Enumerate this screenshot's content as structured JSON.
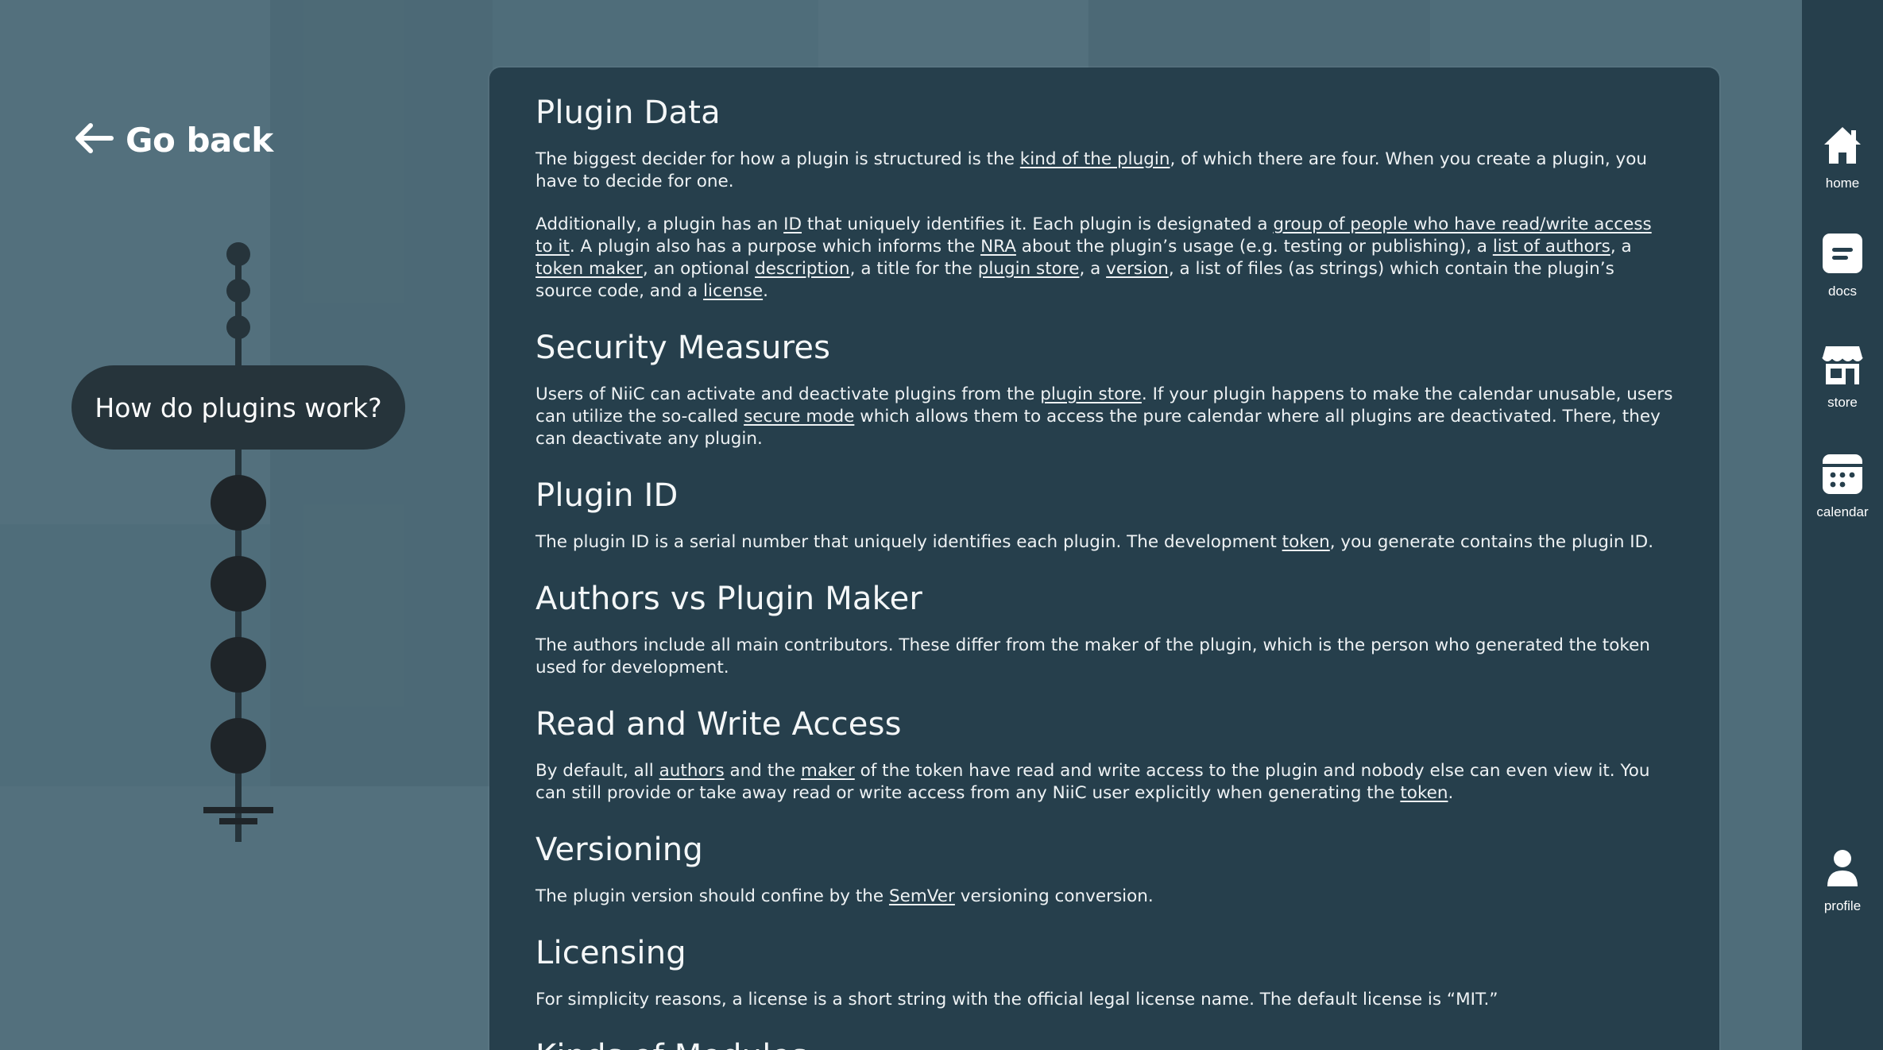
{
  "go_back": {
    "label": "Go back"
  },
  "timeline": {
    "current_step": "How do plugins work?"
  },
  "content": {
    "sections": [
      {
        "title": "Plugin Data",
        "paragraphs": [
          [
            {
              "t": "The biggest decider for how a plugin is structured is the "
            },
            {
              "t": "kind of the plugin",
              "link": true
            },
            {
              "t": ", of which there are four. When you create a plugin, you have to decide for one."
            }
          ],
          [
            {
              "t": "Additionally, a plugin has an "
            },
            {
              "t": "ID",
              "link": true
            },
            {
              "t": " that uniquely identifies it. Each plugin is designated a "
            },
            {
              "t": "group of people who have read/write access to it",
              "link": true
            },
            {
              "t": ". A plugin also has a purpose which informs the "
            },
            {
              "t": "NRA",
              "link": true
            },
            {
              "t": " about the plugin’s usage (e.g. testing or publishing), a "
            },
            {
              "t": "list of authors",
              "link": true
            },
            {
              "t": ", a "
            },
            {
              "t": "token maker",
              "link": true
            },
            {
              "t": ", an optional "
            },
            {
              "t": "description",
              "link": true
            },
            {
              "t": ", a title for the "
            },
            {
              "t": "plugin store",
              "link": true
            },
            {
              "t": ", a  "
            },
            {
              "t": "version",
              "link": true
            },
            {
              "t": ", a list of files (as strings) which contain the plugin’s source code, and a "
            },
            {
              "t": "license",
              "link": true
            },
            {
              "t": "."
            }
          ]
        ]
      },
      {
        "title": "Security Measures",
        "paragraphs": [
          [
            {
              "t": "Users of NiiC can activate and deactivate plugins from the "
            },
            {
              "t": "plugin store",
              "link": true
            },
            {
              "t": ". If your plugin happens to make the calendar unusable, users can utilize the so-called "
            },
            {
              "t": "secure mode",
              "link": true
            },
            {
              "t": " which allows them to access the pure calendar where all plugins are deactivated. There, they can deactivate any plugin."
            }
          ]
        ]
      },
      {
        "title": "Plugin ID",
        "paragraphs": [
          [
            {
              "t": "The plugin ID is a serial number that uniquely identifies each plugin. The development "
            },
            {
              "t": "token",
              "link": true
            },
            {
              "t": ", you generate contains the plugin ID."
            }
          ]
        ]
      },
      {
        "title": "Authors vs Plugin Maker",
        "paragraphs": [
          [
            {
              "t": "The authors include all main contributors. These differ from the maker of the plugin, which is the person who generated the token used for development."
            }
          ]
        ]
      },
      {
        "title": "Read and Write Access",
        "paragraphs": [
          [
            {
              "t": "By default, all "
            },
            {
              "t": "authors",
              "link": true
            },
            {
              "t": " and the "
            },
            {
              "t": "maker",
              "link": true
            },
            {
              "t": " of the token have read and write access to the plugin and nobody else can even view it. You can still provide or take away read or write access from any NiiC user explicitly when generating the "
            },
            {
              "t": "token",
              "link": true
            },
            {
              "t": "."
            }
          ]
        ]
      },
      {
        "title": "Versioning",
        "paragraphs": [
          [
            {
              "t": "The plugin version should confine by the "
            },
            {
              "t": "SemVer",
              "link": true
            },
            {
              "t": " versioning conversion."
            }
          ]
        ]
      },
      {
        "title": "Licensing",
        "paragraphs": [
          [
            {
              "t": "For simplicity reasons, a license is a short string with the official legal license name. The default license is “MIT.”"
            }
          ]
        ]
      },
      {
        "title": "Kinds of Modules",
        "paragraphs": []
      }
    ]
  },
  "nav": {
    "home": "home",
    "docs": "docs",
    "store": "store",
    "calendar": "calendar",
    "profile": "profile"
  }
}
